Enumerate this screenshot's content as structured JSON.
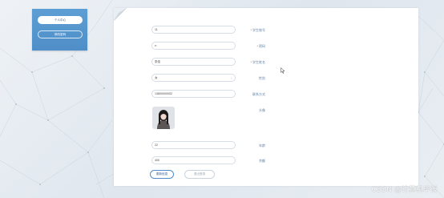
{
  "sidebar": {
    "items": [
      {
        "label": "个人中心",
        "active": true
      },
      {
        "label": "修改密码",
        "active": false
      }
    ]
  },
  "form": {
    "fields": [
      {
        "label": "学生账号",
        "required": true,
        "value": "11"
      },
      {
        "label": "密码",
        "required": true,
        "value": "••"
      },
      {
        "label": "学生姓名",
        "required": true,
        "value": "张佳"
      },
      {
        "label": "性别",
        "required": false,
        "value": "女",
        "type": "select"
      },
      {
        "label": "联系方式",
        "required": false,
        "value": "13800000002"
      }
    ],
    "avatar_label": "头像",
    "extra_fields": [
      {
        "label": "年龄",
        "value": "22"
      },
      {
        "label": "余额",
        "value": "400"
      }
    ],
    "buttons": {
      "update": "更新信息",
      "logout": "退出登录"
    }
  },
  "watermark": "CSDN @计算机毕设"
}
